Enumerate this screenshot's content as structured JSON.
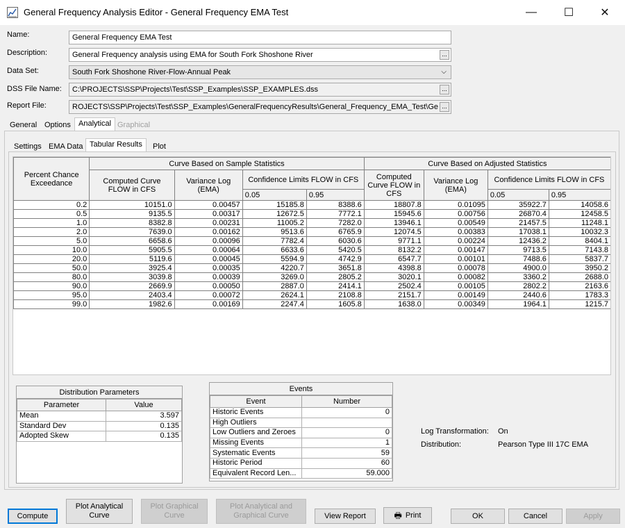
{
  "window": {
    "title": "General Frequency Analysis Editor - General Frequency EMA Test",
    "minimize": "—",
    "maximize": "☐",
    "close": "✕"
  },
  "form": {
    "name_label": "Name:",
    "name_value": "General Frequency EMA Test",
    "description_label": "Description:",
    "description_value": "General Frequency analysis using EMA for South Fork Shoshone River",
    "dataset_label": "Data Set:",
    "dataset_value": "South Fork Shoshone River-Flow-Annual Peak",
    "dss_label": "DSS File Name:",
    "dss_value": "C:\\PROJECTS\\SSP\\Projects\\Test\\SSP_Examples\\SSP_EXAMPLES.dss",
    "report_label": "Report File:",
    "report_value": "ROJECTS\\SSP\\Projects\\Test\\SSP_Examples\\GeneralFrequencyResults\\General_Frequency_EMA_Test\\Ge",
    "ellipsis": "..."
  },
  "main_tabs": [
    "General",
    "Options",
    "Analytical",
    "Graphical"
  ],
  "sub_tabs": [
    "Settings",
    "EMA Data",
    "Tabular Results",
    "Plot"
  ],
  "results": {
    "headers": {
      "percent": "Percent Chance Exceedance",
      "sample_group": "Curve Based on Sample Statistics",
      "adjusted_group": "Curve Based on Adjusted Statistics",
      "computed": "Computed Curve FLOW in CFS",
      "variance": "Variance Log (EMA)",
      "conf_limits": "Confidence Limits FLOW in CFS",
      "c05": "0.05",
      "c95": "0.95"
    },
    "rows": [
      [
        "0.2",
        "10151.0",
        "0.00457",
        "15185.8",
        "8388.6",
        "18807.8",
        "0.01095",
        "35922.7",
        "14058.6"
      ],
      [
        "0.5",
        "9135.5",
        "0.00317",
        "12672.5",
        "7772.1",
        "15945.6",
        "0.00756",
        "26870.4",
        "12458.5"
      ],
      [
        "1.0",
        "8382.8",
        "0.00231",
        "11005.2",
        "7282.0",
        "13946.1",
        "0.00549",
        "21457.5",
        "11248.1"
      ],
      [
        "2.0",
        "7639.0",
        "0.00162",
        "9513.6",
        "6765.9",
        "12074.5",
        "0.00383",
        "17038.1",
        "10032.3"
      ],
      [
        "5.0",
        "6658.6",
        "0.00096",
        "7782.4",
        "6030.6",
        "9771.1",
        "0.00224",
        "12436.2",
        "8404.1"
      ],
      [
        "10.0",
        "5905.5",
        "0.00064",
        "6633.6",
        "5420.5",
        "8132.2",
        "0.00147",
        "9713.5",
        "7143.8"
      ],
      [
        "20.0",
        "5119.6",
        "0.00045",
        "5594.9",
        "4742.9",
        "6547.7",
        "0.00101",
        "7488.6",
        "5837.7"
      ],
      [
        "50.0",
        "3925.4",
        "0.00035",
        "4220.7",
        "3651.8",
        "4398.8",
        "0.00078",
        "4900.0",
        "3950.2"
      ],
      [
        "80.0",
        "3039.8",
        "0.00039",
        "3269.0",
        "2805.2",
        "3020.1",
        "0.00082",
        "3360.2",
        "2688.0"
      ],
      [
        "90.0",
        "2669.9",
        "0.00050",
        "2887.0",
        "2414.1",
        "2502.4",
        "0.00105",
        "2802.2",
        "2163.6"
      ],
      [
        "95.0",
        "2403.4",
        "0.00072",
        "2624.1",
        "2108.8",
        "2151.7",
        "0.00149",
        "2440.6",
        "1783.3"
      ],
      [
        "99.0",
        "1982.6",
        "0.00169",
        "2247.4",
        "1605.8",
        "1638.0",
        "0.00349",
        "1964.1",
        "1215.7"
      ]
    ]
  },
  "distribution": {
    "title": "Distribution Parameters",
    "col_parameter": "Parameter",
    "col_value": "Value",
    "rows": [
      [
        "Mean",
        "3.597"
      ],
      [
        "Standard Dev",
        "0.135"
      ],
      [
        "Adopted Skew",
        "0.135"
      ]
    ]
  },
  "events": {
    "title": "Events",
    "col_event": "Event",
    "col_number": "Number",
    "rows": [
      [
        "Historic Events",
        "0"
      ],
      [
        "High Outliers",
        ""
      ],
      [
        "Low Outliers and Zeroes",
        "0"
      ],
      [
        "Missing Events",
        "1"
      ],
      [
        "Systematic Events",
        "59"
      ],
      [
        "Historic Period",
        "60"
      ],
      [
        "Equivalent Record Len...",
        "59.000"
      ]
    ]
  },
  "info": {
    "log_label": "Log Transformation:",
    "log_value": "On",
    "dist_label": "Distribution:",
    "dist_value": "Pearson Type III 17C EMA"
  },
  "buttons": {
    "compute": "Compute",
    "plot_analytical": "Plot Analytical Curve",
    "plot_graphical": "Plot Graphical Curve",
    "plot_both": "Plot Analytical and Graphical Curve",
    "view_report": "View Report",
    "print": "Print",
    "ok": "OK",
    "cancel": "Cancel",
    "apply": "Apply"
  }
}
